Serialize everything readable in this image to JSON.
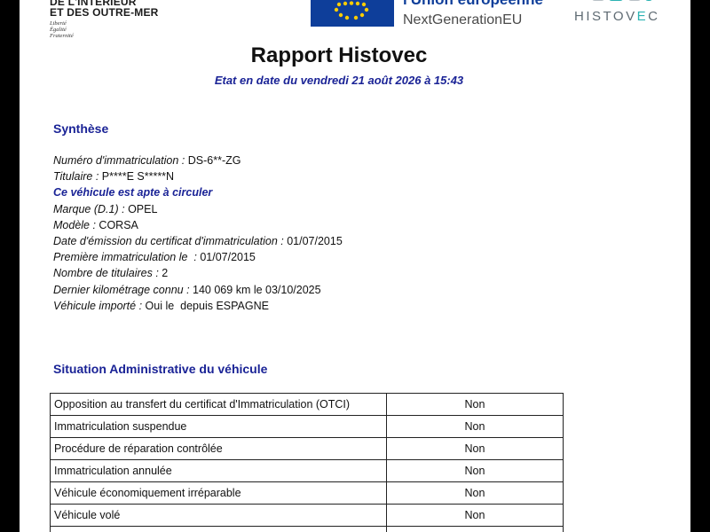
{
  "header": {
    "ministry_lines": [
      "DE L'INTÉRIEUR",
      "ET DES OUTRE-MER"
    ],
    "motto": [
      "Liberté",
      "Égalité",
      "Fraternité"
    ],
    "eu_line1": "l'Union européenne",
    "eu_line2": "NextGenerationEU",
    "logo_text_pre": "HISTOV",
    "logo_text_accent": "E",
    "logo_text_post": "C"
  },
  "title": "Rapport Histovec",
  "subtitle": "Etat en date du vendredi 21 août 2026 à 15:43",
  "synthese": {
    "heading": "Synthèse",
    "rows": [
      {
        "label": "Numéro d'immatriculation : ",
        "value": "DS-6**-ZG"
      },
      {
        "label": "Titulaire : ",
        "value": "P****E S*****N"
      },
      {
        "label": "",
        "value": "Ce véhicule est apte à circuler"
      },
      {
        "label": "Marque (D.1) : ",
        "value": "OPEL"
      },
      {
        "label": "Modèle : ",
        "value": "CORSA"
      },
      {
        "label": "Date d'émission du certificat d'immatriculation : ",
        "value": "01/07/2015"
      },
      {
        "label": "Première immatriculation le  : ",
        "value": "01/07/2015"
      },
      {
        "label": "Nombre de titulaires : ",
        "value": "2"
      },
      {
        "label": "Dernier kilométrage connu : ",
        "value": "140 069 km le 03/10/2025"
      },
      {
        "label": "Véhicule importé : ",
        "value": "Oui le  depuis ESPAGNE"
      }
    ]
  },
  "situation": {
    "heading": "Situation Administrative du véhicule",
    "rows": [
      {
        "label": "Opposition au transfert du certificat d'Immatriculation (OTCI)",
        "value": "Non"
      },
      {
        "label": "Immatriculation suspendue",
        "value": "Non"
      },
      {
        "label": "Procédure de réparation contrôlée",
        "value": "Non"
      },
      {
        "label": "Immatriculation annulée",
        "value": "Non"
      },
      {
        "label": "Véhicule économiquement irréparable",
        "value": "Non"
      },
      {
        "label": "Véhicule volé",
        "value": "Non"
      },
      {
        "label": "",
        "value": ""
      }
    ]
  },
  "colors": {
    "accent_blue": "#1a2396",
    "eu_blue": "#0e3e9a",
    "eu_star": "#ffcc00",
    "logo_teal": "#2bb3b3"
  },
  "icons": {
    "eu_flag": "eu-flag-icon",
    "histovec_logo": "histovec-logo-icon"
  }
}
